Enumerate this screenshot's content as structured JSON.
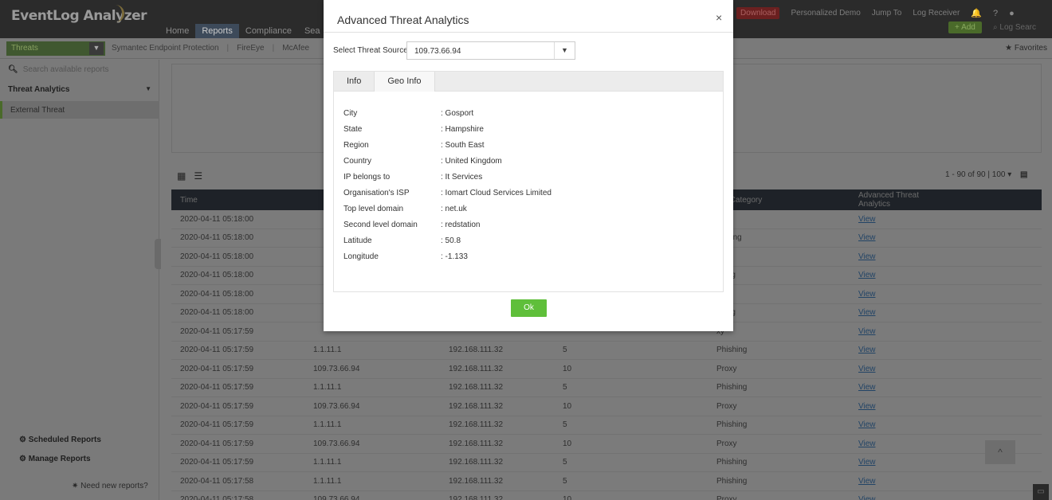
{
  "app": {
    "title": "EventLog Analyzer",
    "nav": [
      "Home",
      "Reports",
      "Compliance",
      "Sea"
    ],
    "active_nav": "Reports",
    "right_nav": {
      "download": "Download",
      "personalized_demo": "Personalized Demo",
      "jump_to": "Jump To",
      "log_receiver": "Log Receiver",
      "help": "?",
      "add": "+ Add",
      "log_search": "Log Searc"
    }
  },
  "subbar": {
    "selected_category": "Threats",
    "tabs": [
      "Symantec Endpoint Protection",
      "FireEye",
      "McAfee"
    ],
    "favorites": "Favorites"
  },
  "sidebar": {
    "search_placeholder": "Search available reports",
    "category": "Threat Analytics",
    "selected_item": "External Threat",
    "scheduled_reports": "Scheduled Reports",
    "manage_reports": "Manage Reports",
    "need_new_reports": "Need new reports?"
  },
  "grid": {
    "pager": "1 - 90 of 90",
    "page_size": "100",
    "headers": {
      "time": "Time",
      "category": "eat Category",
      "ata": "Advanced Threat Analytics"
    },
    "rows": [
      {
        "time": "2020-04-11 05:18:00",
        "src": "",
        "dst": "",
        "sev": "",
        "cat": "xy",
        "link": "View"
      },
      {
        "time": "2020-04-11 05:18:00",
        "src": "",
        "dst": "",
        "sev": "",
        "cat": "hishing",
        "link": "View"
      },
      {
        "time": "2020-04-11 05:18:00",
        "src": "",
        "dst": "",
        "sev": "",
        "cat": "xy",
        "link": "View"
      },
      {
        "time": "2020-04-11 05:18:00",
        "src": "",
        "dst": "",
        "sev": "",
        "cat": "shing",
        "link": "View"
      },
      {
        "time": "2020-04-11 05:18:00",
        "src": "",
        "dst": "",
        "sev": "",
        "cat": "xy",
        "link": "View"
      },
      {
        "time": "2020-04-11 05:18:00",
        "src": "",
        "dst": "",
        "sev": "",
        "cat": "shing",
        "link": "View"
      },
      {
        "time": "2020-04-11 05:17:59",
        "src": "",
        "dst": "",
        "sev": "",
        "cat": "xy",
        "link": "View"
      },
      {
        "time": "2020-04-11 05:17:59",
        "src": "1.1.11.1",
        "dst": "192.168.111.32",
        "sev": "5",
        "cat": "Phishing",
        "link": "View"
      },
      {
        "time": "2020-04-11 05:17:59",
        "src": "109.73.66.94",
        "dst": "192.168.111.32",
        "sev": "10",
        "cat": "Proxy",
        "link": "View"
      },
      {
        "time": "2020-04-11 05:17:59",
        "src": "1.1.11.1",
        "dst": "192.168.111.32",
        "sev": "5",
        "cat": "Phishing",
        "link": "View"
      },
      {
        "time": "2020-04-11 05:17:59",
        "src": "109.73.66.94",
        "dst": "192.168.111.32",
        "sev": "10",
        "cat": "Proxy",
        "link": "View"
      },
      {
        "time": "2020-04-11 05:17:59",
        "src": "1.1.11.1",
        "dst": "192.168.111.32",
        "sev": "5",
        "cat": "Phishing",
        "link": "View"
      },
      {
        "time": "2020-04-11 05:17:59",
        "src": "109.73.66.94",
        "dst": "192.168.111.32",
        "sev": "10",
        "cat": "Proxy",
        "link": "View"
      },
      {
        "time": "2020-04-11 05:17:59",
        "src": "1.1.11.1",
        "dst": "192.168.111.32",
        "sev": "5",
        "cat": "Phishing",
        "link": "View"
      },
      {
        "time": "2020-04-11 05:17:58",
        "src": "1.1.11.1",
        "dst": "192.168.111.32",
        "sev": "5",
        "cat": "Phishing",
        "link": "View"
      },
      {
        "time": "2020-04-11 05:17:58",
        "src": "109.73.66.94",
        "dst": "192.168.111.32",
        "sev": "10",
        "cat": "Proxy",
        "link": "View"
      }
    ]
  },
  "modal": {
    "title": "Advanced Threat Analytics",
    "close": "×",
    "source_label": "Select Threat Source",
    "source_value": "109.73.66.94",
    "tabs": [
      "Info",
      "Geo Info"
    ],
    "active_tab": "Geo Info",
    "geo": [
      {
        "key": "City",
        "value": ": Gosport"
      },
      {
        "key": "State",
        "value": ": Hampshire"
      },
      {
        "key": "Region",
        "value": ": South East"
      },
      {
        "key": "Country",
        "value": ": United Kingdom"
      },
      {
        "key": "IP belongs to",
        "value": ": It Services"
      },
      {
        "key": "Organisation's ISP",
        "value": ": Iomart Cloud Services Limited"
      },
      {
        "key": "Top level domain",
        "value": ": net.uk"
      },
      {
        "key": "Second level domain",
        "value": ": redstation"
      },
      {
        "key": "Latitude",
        "value": ": 50.8"
      },
      {
        "key": "Longitude",
        "value": ": -1.133"
      }
    ],
    "ok_label": "Ok"
  },
  "colors": {
    "accent_green": "#5fbf3a",
    "grid_header": "#1e2228",
    "overlay": "#7b7b7b"
  }
}
